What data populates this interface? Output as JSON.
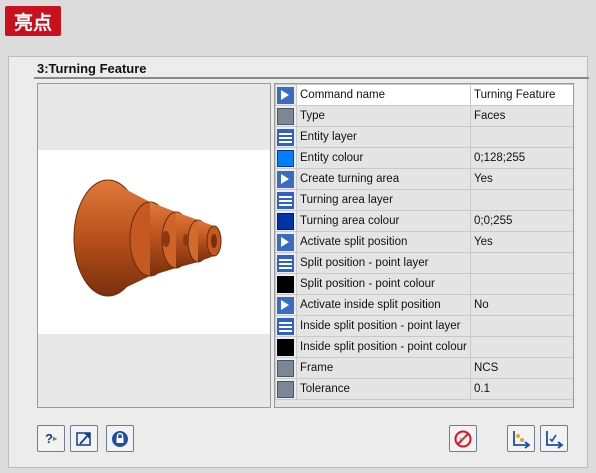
{
  "badge": {
    "label": "亮点"
  },
  "window": {
    "title": "3:Turning Feature"
  },
  "properties": [
    {
      "icon": "command-icon",
      "name": "Command name",
      "value": "Turning Feature"
    },
    {
      "icon": "type-icon",
      "name": "Type",
      "value": "Faces"
    },
    {
      "icon": "layer-icon",
      "name": "Entity layer",
      "value": ""
    },
    {
      "icon": "colour-swatch-icon",
      "name": "Entity colour",
      "value": "0;128;255"
    },
    {
      "icon": "command-icon",
      "name": "Create turning area",
      "value": "Yes"
    },
    {
      "icon": "layer-icon",
      "name": "Turning area layer",
      "value": ""
    },
    {
      "icon": "colour-swatch-icon",
      "name": "Turning area colour",
      "value": "0;0;255"
    },
    {
      "icon": "command-icon",
      "name": "Activate split position",
      "value": "Yes"
    },
    {
      "icon": "layer-icon",
      "name": "Split position - point layer",
      "value": ""
    },
    {
      "icon": "colour-swatch-icon",
      "name": "Split position - point colour",
      "value": ""
    },
    {
      "icon": "command-icon",
      "name": "Activate inside split position",
      "value": "No"
    },
    {
      "icon": "layer-icon",
      "name": "Inside split position - point layer",
      "value": ""
    },
    {
      "icon": "colour-swatch-icon",
      "name": "Inside split position - point colour",
      "value": ""
    },
    {
      "icon": "type-icon",
      "name": "Frame",
      "value": "NCS"
    },
    {
      "icon": "type-icon",
      "name": "Tolerance",
      "value": "0.1"
    }
  ],
  "colors": {
    "badge": "#c8101e",
    "entity_colour": "#0080ff",
    "turning_area_colour": "#0000ff",
    "part": "#c0561c"
  },
  "buttons": {
    "help": {
      "icon": "help-icon"
    },
    "edit": {
      "icon": "pick-arrow-icon"
    },
    "lock": {
      "icon": "lock-icon"
    },
    "cancel": {
      "icon": "cancel-icon"
    },
    "next1": {
      "icon": "apply-icon"
    },
    "next2": {
      "icon": "apply-next-icon"
    }
  }
}
